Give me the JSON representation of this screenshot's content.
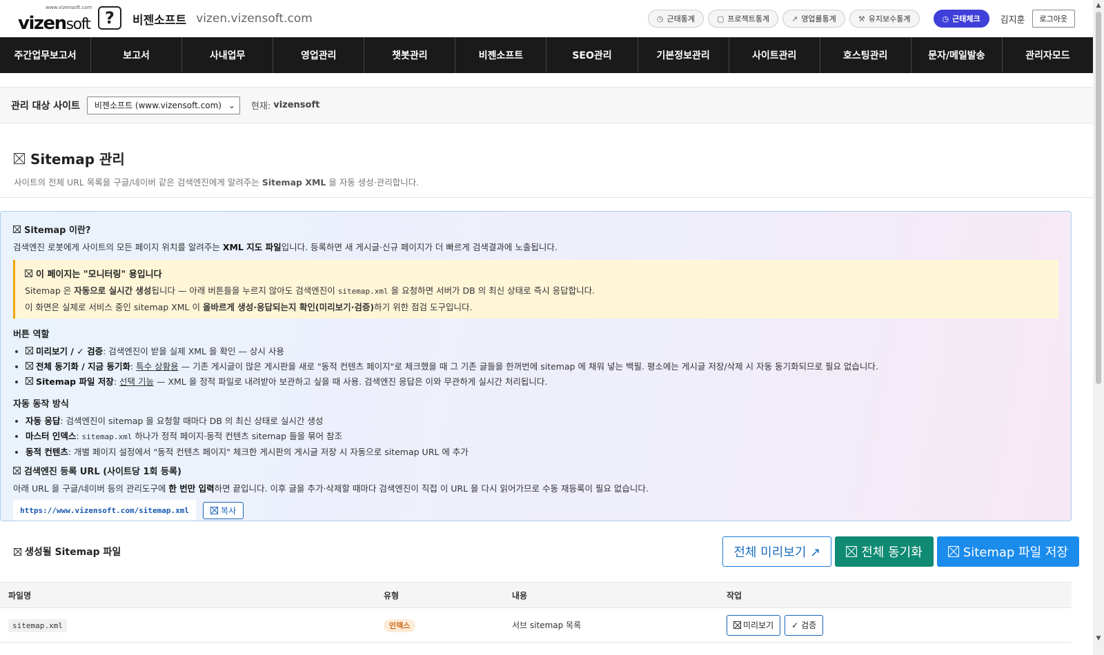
{
  "header": {
    "logo_url_text": "www.vizensoft.com",
    "logo_word_bold": "vizen",
    "logo_word_light": "soft",
    "logo_mark": "?",
    "brand_name": "비젠소프트",
    "brand_domain": "vizen.vizensoft.com",
    "stat_pills": [
      {
        "icon": "clock-icon",
        "glyph": "◷",
        "label": "근태통계"
      },
      {
        "icon": "clipboard-icon",
        "glyph": "▢",
        "label": "프로젝트통계"
      },
      {
        "icon": "trend-icon",
        "glyph": "↗",
        "label": "영업률통계"
      },
      {
        "icon": "wrench-icon",
        "glyph": "⚒",
        "label": "유지보수통계"
      }
    ],
    "checkin": {
      "glyph": "◷",
      "label": "근태체크"
    },
    "username": "김지훈",
    "logout_label": "로그아웃"
  },
  "nav": [
    "주간업무보고서",
    "보고서",
    "사내업무",
    "영업관리",
    "챗봇관리",
    "비젠소프트",
    "SEO관리",
    "기본정보관리",
    "사이트관리",
    "호스팅관리",
    "문자/메일발송",
    "관리자모드"
  ],
  "site_selector": {
    "label": "관리 대상 사이트",
    "selected": "비젠소프트 (www.vizensoft.com)",
    "current_label": "현재:",
    "current_value": "vizensoft"
  },
  "page": {
    "title": "Sitemap 관리",
    "desc_pre": "사이트의 전체 URL 목록을 구글/네이버 같은 검색엔진에게 알려주는 ",
    "desc_bold": "Sitemap XML",
    "desc_post": " 을 자동 생성·관리합니다."
  },
  "info": {
    "what_title": "Sitemap 이란?",
    "what_pre": "검색엔진 로봇에게 사이트의 모든 페이지 위치를 알려주는 ",
    "what_bold": "XML 지도 파일",
    "what_post": "입니다. 등록하면 새 게시글·신규 페이지가 더 빠르게 검색결과에 노출됩니다.",
    "notice_title": "이 페이지는 \"모니터링\" 용입니다",
    "notice_l1_pre": "Sitemap 은 ",
    "notice_l1_bold": "자동으로 실시간 생성",
    "notice_l1_mid": "됩니다 — 아래 버튼들을 누르지 않아도 검색엔진이 ",
    "notice_l1_code": "sitemap.xml",
    "notice_l1_post": " 을 요청하면 서버가 DB 의 최신 상태로 즉시 응답합니다.",
    "notice_l2_pre": "이 화면은 실제로 서비스 중인 sitemap XML 이 ",
    "notice_l2_bold": "올바르게 생성·응답되는지 확인(미리보기·검증)",
    "notice_l2_post": "하기 위한 점검 도구입니다.",
    "roles_title": "버튼 역할",
    "role1_bold": "미리보기 / ✓ 검증",
    "role1_text": ": 검색엔진이 받을 실제 XML 을 확인 — 상시 사용",
    "role2_bold": "전체 동기화 / 지금 동기화",
    "role2_sep": ": ",
    "role2_u": "특수 상황용",
    "role2_text": " — 기존 게시글이 많은 게시판을 새로 \"동적 컨텐츠 페이지\"로 체크했을 때 그 기존 글들을 한꺼번에 sitemap 에 채워 넣는 백필. 평소에는 게시글 저장/삭제 시 자동 동기화되므로 필요 없습니다.",
    "role3_bold": "Sitemap 파일 저장",
    "role3_sep": ": ",
    "role3_u": "선택 기능",
    "role3_text": " — XML 을 정적 파일로 내려받아 보관하고 싶을 때 사용. 검색엔진 응답은 이와 무관하게 실시간 처리됩니다.",
    "auto_title": "자동 동작 방식",
    "auto1_bold": "자동 응답",
    "auto1_text": ": 검색엔진이 sitemap 을 요청할 때마다 DB 의 최신 상태로 실시간 생성",
    "auto2_bold": "마스터 인덱스",
    "auto2_sep": ": ",
    "auto2_code": "sitemap.xml",
    "auto2_text": " 하나가 정적 페이지·동적 컨텐츠 sitemap 들을 묶어 참조",
    "auto3_bold": "동적 컨텐츠",
    "auto3_text": ": 개별 페이지 설정에서 \"동적 컨텐츠 페이지\" 체크한 게시판의 게시글 저장 시 자동으로 sitemap URL 에 추가",
    "reg_title": "검색엔진 등록 URL (사이트당 1회 등록)",
    "reg_pre": "아래 URL 을 구글/네이버 등의 관리도구에 ",
    "reg_bold": "한 번만 입력",
    "reg_post": "하면 끝입니다. 이후 글을 추가·삭제할 때마다 검색엔진이 직접 이 URL 을 다시 읽어가므로 수동 재등록이 필요 없습니다.",
    "sitemap_url": "https://www.vizensoft.com/sitemap.xml",
    "copy_label": "복사"
  },
  "files": {
    "title": "생성될 Sitemap 파일",
    "preview_all_label": "전체 미리보기 ↗",
    "sync_all_label": "전체 동기화",
    "save_label": "Sitemap 파일 저장",
    "columns": [
      "파일명",
      "유형",
      "내용",
      "작업"
    ],
    "rows": [
      {
        "filename": "sitemap.xml",
        "type": "인덱스",
        "content": "서브 sitemap 목록",
        "preview_label": "미리보기",
        "verify_label": "✓ 검증"
      }
    ]
  },
  "colors": {
    "nav_bg": "#1a1a1a",
    "checkin_accent": "#3f3fd9",
    "teal_button": "#0f8a73",
    "blue_button": "#1b8cec",
    "notice_bg": "#fff6d8",
    "notice_border": "#f0a500",
    "badge_bg": "#fdecd8",
    "badge_text": "#c9681b"
  }
}
